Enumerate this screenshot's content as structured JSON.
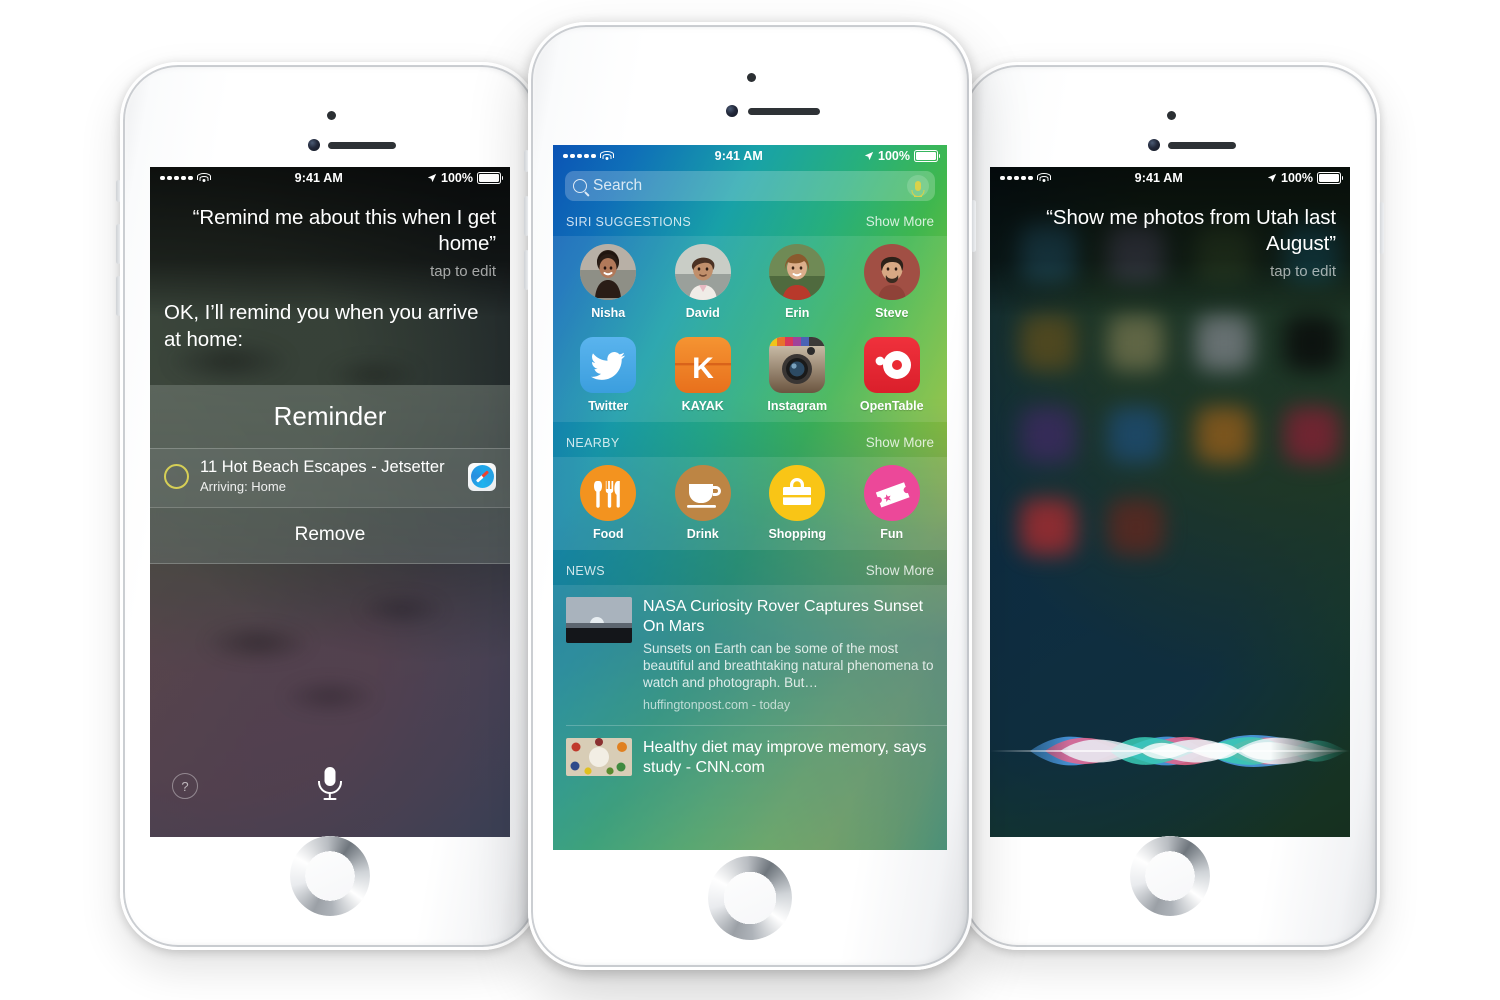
{
  "left_phone": {
    "status": {
      "time": "9:41 AM",
      "battery": "100%",
      "signal_dots": 5,
      "wifi": "wifi-icon",
      "location": "location-arrow-icon"
    },
    "utterance": "“Remind me about this when I get home”",
    "tap_to_edit": "tap to edit",
    "reply": "OK, I’ll remind you when you arrive at home:",
    "card": {
      "title": "Reminder",
      "item_name": "11 Hot Beach Escapes - Jetsetter",
      "item_sub": "Arriving: Home",
      "app_icon": "safari-icon",
      "remove_label": "Remove"
    },
    "help_label": "?",
    "mic": "microphone-icon"
  },
  "center_phone": {
    "status": {
      "time": "9:41 AM",
      "battery": "100%",
      "signal_dots": 5,
      "wifi": "wifi-icon",
      "location": "location-arrow-icon"
    },
    "search": {
      "placeholder": "Search",
      "icon": "search-icon",
      "mic_icon": "microphone-icon"
    },
    "sections": [
      {
        "title": "SIRI SUGGESTIONS",
        "more": "Show More",
        "contacts": [
          {
            "name": "Nisha",
            "avatar": "avatar-nisha"
          },
          {
            "name": "David",
            "avatar": "avatar-david"
          },
          {
            "name": "Erin",
            "avatar": "avatar-erin"
          },
          {
            "name": "Steve",
            "avatar": "avatar-steve"
          }
        ],
        "apps": [
          {
            "name": "Twitter",
            "icon": "twitter-icon",
            "color": "#48a8e8"
          },
          {
            "name": "KAYAK",
            "icon": "kayak-icon",
            "color": "#ef8024"
          },
          {
            "name": "Instagram",
            "icon": "instagram-icon",
            "color": "#c7b49a"
          },
          {
            "name": "OpenTable",
            "icon": "opentable-icon",
            "color": "#ea2a33"
          }
        ]
      },
      {
        "title": "NEARBY",
        "more": "Show More",
        "categories": [
          {
            "name": "Food",
            "icon": "cutlery-icon",
            "color": "#f3931f"
          },
          {
            "name": "Drink",
            "icon": "coffee-cup-icon",
            "color": "#bd8544"
          },
          {
            "name": "Shopping",
            "icon": "shopping-bag-icon",
            "color": "#f9c516"
          },
          {
            "name": "Fun",
            "icon": "ticket-icon",
            "color": "#ec4899"
          }
        ]
      },
      {
        "title": "NEWS",
        "more": "Show More",
        "articles": [
          {
            "title": "NASA Curiosity Rover Captures Sunset On Mars",
            "desc": "Sunsets on Earth can be some of the most beautiful and breathtaking natural phenomena to watch and photograph. But…",
            "source": "huffingtonpost.com - today",
            "thumb": "mars-sunset-thumbnail"
          },
          {
            "title": "Healthy diet may improve memory, says study - CNN.com",
            "desc": "",
            "source": "",
            "thumb": "healthy-food-thumbnail"
          }
        ]
      }
    ]
  },
  "right_phone": {
    "status": {
      "time": "9:41 AM",
      "battery": "100%",
      "signal_dots": 5,
      "wifi": "wifi-icon",
      "location": "location-arrow-icon"
    },
    "utterance": "“Show me photos from Utah last August”",
    "tap_to_edit": "tap to edit",
    "waveform": "siri-waveform"
  },
  "colors": {
    "siri_wave_blue": "#3d7fd4",
    "siri_wave_pink": "#e8436b",
    "siri_wave_teal": "#2bbfa0",
    "accent_yellow": "#d9d24a"
  }
}
